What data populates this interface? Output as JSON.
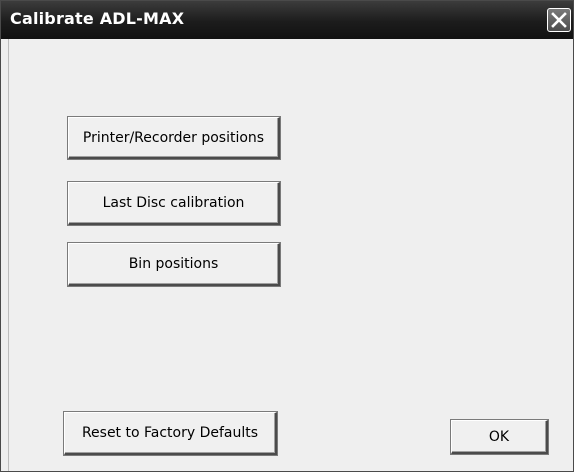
{
  "window": {
    "title": "Calibrate ADL-MAX",
    "close_icon": "close-icon"
  },
  "buttons": {
    "printer_recorder": "Printer/Recorder positions",
    "last_disc": "Last Disc calibration",
    "bin_positions": "Bin positions",
    "reset_defaults": "Reset to Factory Defaults",
    "ok": "OK"
  },
  "colors": {
    "titlebar": "#1c1c1c",
    "title_text": "#ffffff",
    "dialog_background": "#efefef"
  }
}
